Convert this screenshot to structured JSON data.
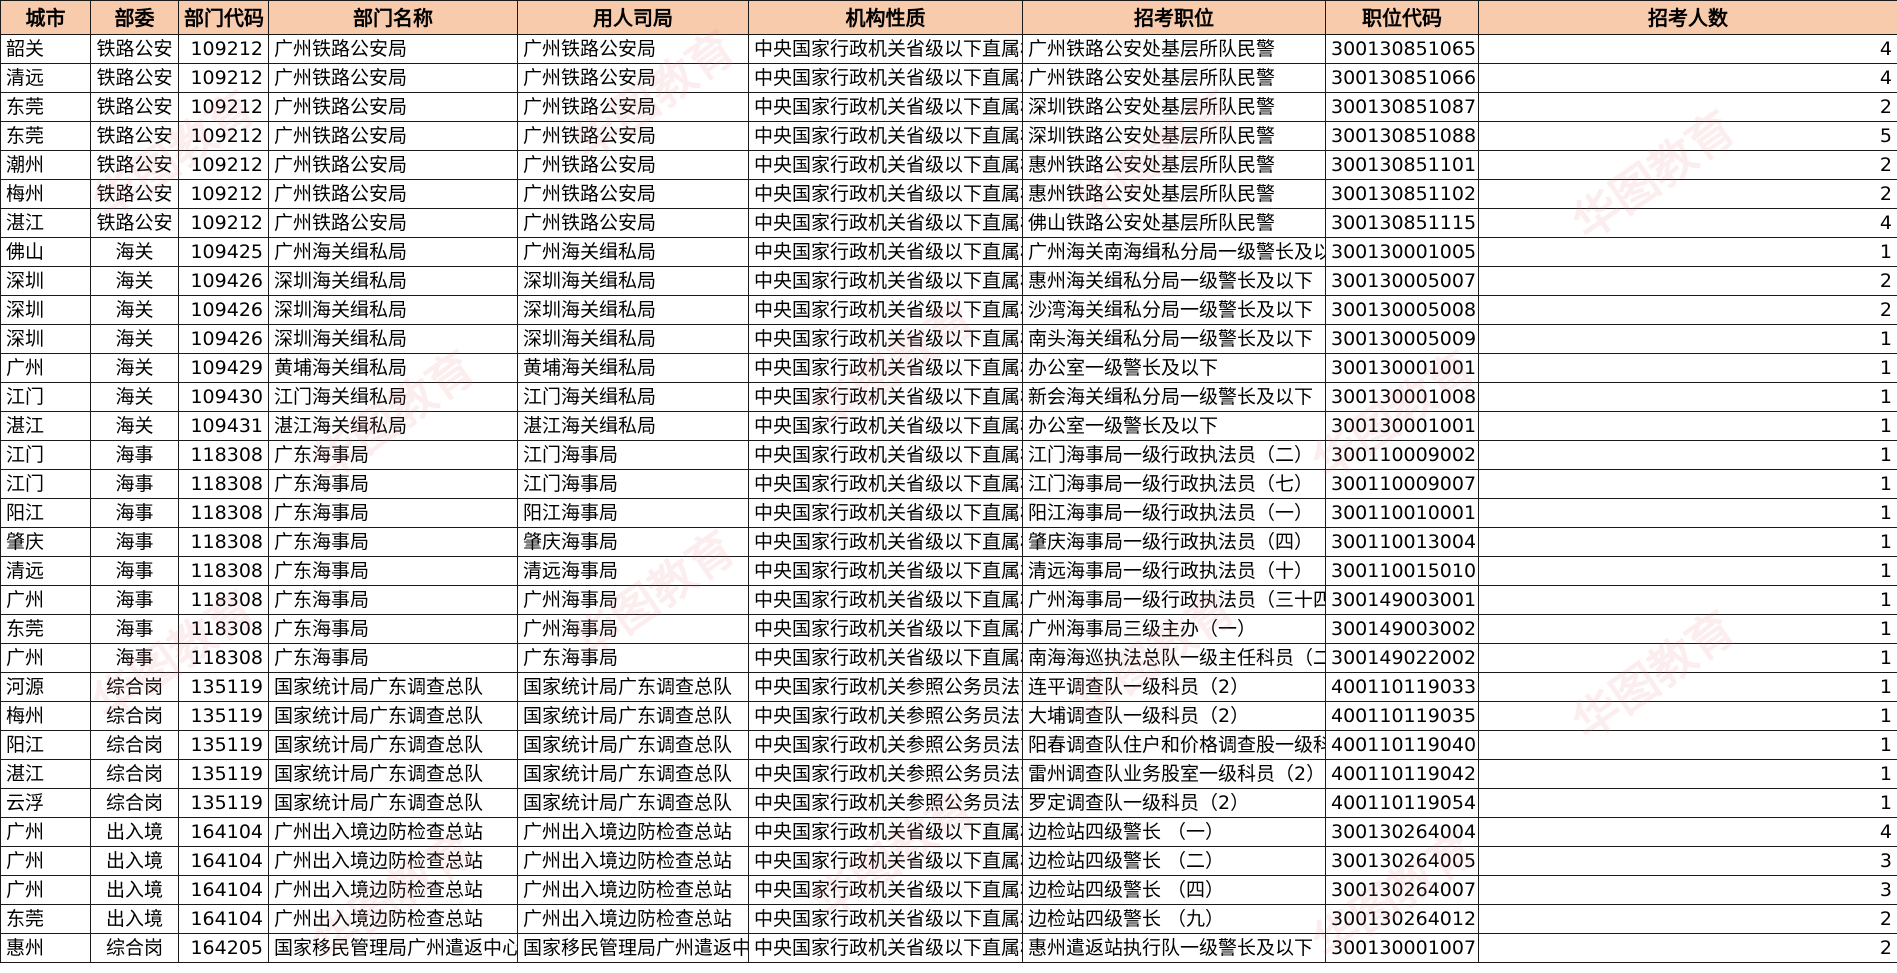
{
  "headers": [
    "城市",
    "部委",
    "部门代码",
    "部门名称",
    "用人司局",
    "机构性质",
    "招考职位",
    "职位代码",
    "招考人数"
  ],
  "watermark": "华图教育",
  "rows": [
    [
      "韶关",
      "铁路公安",
      "109212",
      "广州铁路公安局",
      "广州铁路公安局",
      "中央国家行政机关省级以下直属机构",
      "广州铁路公安处基层所队民警",
      "300130851065",
      "4"
    ],
    [
      "清远",
      "铁路公安",
      "109212",
      "广州铁路公安局",
      "广州铁路公安局",
      "中央国家行政机关省级以下直属机构",
      "广州铁路公安处基层所队民警",
      "300130851066",
      "4"
    ],
    [
      "东莞",
      "铁路公安",
      "109212",
      "广州铁路公安局",
      "广州铁路公安局",
      "中央国家行政机关省级以下直属机构",
      "深圳铁路公安处基层所队民警",
      "300130851087",
      "2"
    ],
    [
      "东莞",
      "铁路公安",
      "109212",
      "广州铁路公安局",
      "广州铁路公安局",
      "中央国家行政机关省级以下直属机构",
      "深圳铁路公安处基层所队民警",
      "300130851088",
      "5"
    ],
    [
      "潮州",
      "铁路公安",
      "109212",
      "广州铁路公安局",
      "广州铁路公安局",
      "中央国家行政机关省级以下直属机构",
      "惠州铁路公安处基层所队民警",
      "300130851101",
      "2"
    ],
    [
      "梅州",
      "铁路公安",
      "109212",
      "广州铁路公安局",
      "广州铁路公安局",
      "中央国家行政机关省级以下直属机构",
      "惠州铁路公安处基层所队民警",
      "300130851102",
      "2"
    ],
    [
      "湛江",
      "铁路公安",
      "109212",
      "广州铁路公安局",
      "广州铁路公安局",
      "中央国家行政机关省级以下直属机构",
      "佛山铁路公安处基层所队民警",
      "300130851115",
      "4"
    ],
    [
      "佛山",
      "海关",
      "109425",
      "广州海关缉私局",
      "广州海关缉私局",
      "中央国家行政机关省级以下直属机构",
      "广州海关南海缉私分局一级警长及以下",
      "300130001005",
      "1"
    ],
    [
      "深圳",
      "海关",
      "109426",
      "深圳海关缉私局",
      "深圳海关缉私局",
      "中央国家行政机关省级以下直属机构",
      "惠州海关缉私分局一级警长及以下",
      "300130005007",
      "2"
    ],
    [
      "深圳",
      "海关",
      "109426",
      "深圳海关缉私局",
      "深圳海关缉私局",
      "中央国家行政机关省级以下直属机构",
      "沙湾海关缉私分局一级警长及以下",
      "300130005008",
      "2"
    ],
    [
      "深圳",
      "海关",
      "109426",
      "深圳海关缉私局",
      "深圳海关缉私局",
      "中央国家行政机关省级以下直属机构",
      "南头海关缉私分局一级警长及以下",
      "300130005009",
      "1"
    ],
    [
      "广州",
      "海关",
      "109429",
      "黄埔海关缉私局",
      "黄埔海关缉私局",
      "中央国家行政机关省级以下直属机构",
      "办公室一级警长及以下",
      "300130001001",
      "1"
    ],
    [
      "江门",
      "海关",
      "109430",
      "江门海关缉私局",
      "江门海关缉私局",
      "中央国家行政机关省级以下直属机构",
      "新会海关缉私分局一级警长及以下",
      "300130001008",
      "1"
    ],
    [
      "湛江",
      "海关",
      "109431",
      "湛江海关缉私局",
      "湛江海关缉私局",
      "中央国家行政机关省级以下直属机构",
      "办公室一级警长及以下",
      "300130001001",
      "1"
    ],
    [
      "江门",
      "海事",
      "118308",
      "广东海事局",
      "江门海事局",
      "中央国家行政机关省级以下直属机构",
      "江门海事局一级行政执法员（二）",
      "300110009002",
      "1"
    ],
    [
      "江门",
      "海事",
      "118308",
      "广东海事局",
      "江门海事局",
      "中央国家行政机关省级以下直属机构",
      "江门海事局一级行政执法员（七）",
      "300110009007",
      "1"
    ],
    [
      "阳江",
      "海事",
      "118308",
      "广东海事局",
      "阳江海事局",
      "中央国家行政机关省级以下直属机构",
      "阳江海事局一级行政执法员（一）",
      "300110010001",
      "1"
    ],
    [
      "肇庆",
      "海事",
      "118308",
      "广东海事局",
      "肇庆海事局",
      "中央国家行政机关省级以下直属机构",
      "肇庆海事局一级行政执法员（四）",
      "300110013004",
      "1"
    ],
    [
      "清远",
      "海事",
      "118308",
      "广东海事局",
      "清远海事局",
      "中央国家行政机关省级以下直属机构",
      "清远海事局一级行政执法员（十）",
      "300110015010",
      "1"
    ],
    [
      "广州",
      "海事",
      "118308",
      "广东海事局",
      "广州海事局",
      "中央国家行政机关省级以下直属机构",
      "广州海事局一级行政执法员（三十四）",
      "300149003001",
      "1"
    ],
    [
      "东莞",
      "海事",
      "118308",
      "广东海事局",
      "广州海事局",
      "中央国家行政机关省级以下直属机构",
      "广州海事局三级主办（一）",
      "300149003002",
      "1"
    ],
    [
      "广州",
      "海事",
      "118308",
      "广东海事局",
      "广东海事局",
      "中央国家行政机关省级以下直属机构",
      "南海海巡执法总队一级主任科员（二）",
      "300149022002",
      "1"
    ],
    [
      "河源",
      "综合岗",
      "135119",
      "国家统计局广东调查总队",
      "国家统计局广东调查总队",
      "中央国家行政机关参照公务员法管理事业单位",
      "连平调查队一级科员（2）",
      "400110119033",
      "1"
    ],
    [
      "梅州",
      "综合岗",
      "135119",
      "国家统计局广东调查总队",
      "国家统计局广东调查总队",
      "中央国家行政机关参照公务员法管理事业单位",
      "大埔调查队一级科员（2）",
      "400110119035",
      "1"
    ],
    [
      "阳江",
      "综合岗",
      "135119",
      "国家统计局广东调查总队",
      "国家统计局广东调查总队",
      "中央国家行政机关参照公务员法管理事业单位",
      "阳春调查队住户和价格调查股一级科员",
      "400110119040",
      "1"
    ],
    [
      "湛江",
      "综合岗",
      "135119",
      "国家统计局广东调查总队",
      "国家统计局广东调查总队",
      "中央国家行政机关参照公务员法管理事业单位",
      "雷州调查队业务股室一级科员（2）",
      "400110119042",
      "1"
    ],
    [
      "云浮",
      "综合岗",
      "135119",
      "国家统计局广东调查总队",
      "国家统计局广东调查总队",
      "中央国家行政机关参照公务员法管理事业单位",
      "罗定调查队一级科员（2）",
      "400110119054",
      "1"
    ],
    [
      "广州",
      "出入境",
      "164104",
      "广州出入境边防检查总站",
      "广州出入境边防检查总站",
      "中央国家行政机关省级以下直属机构",
      "边检站四级警长 （一）",
      "300130264004",
      "4"
    ],
    [
      "广州",
      "出入境",
      "164104",
      "广州出入境边防检查总站",
      "广州出入境边防检查总站",
      "中央国家行政机关省级以下直属机构",
      "边检站四级警长 （二）",
      "300130264005",
      "3"
    ],
    [
      "广州",
      "出入境",
      "164104",
      "广州出入境边防检查总站",
      "广州出入境边防检查总站",
      "中央国家行政机关省级以下直属机构",
      "边检站四级警长 （四）",
      "300130264007",
      "3"
    ],
    [
      "东莞",
      "出入境",
      "164104",
      "广州出入境边防检查总站",
      "广州出入境边防检查总站",
      "中央国家行政机关省级以下直属机构",
      "边检站四级警长 （九）",
      "300130264012",
      "2"
    ],
    [
      "惠州",
      "综合岗",
      "164205",
      "国家移民管理局广州遣返中心",
      "国家移民管理局广州遣返中心",
      "中央国家行政机关省级以下直属机构",
      "惠州遣返站执行队一级警长及以下（六）",
      "300130001007",
      "2"
    ]
  ]
}
